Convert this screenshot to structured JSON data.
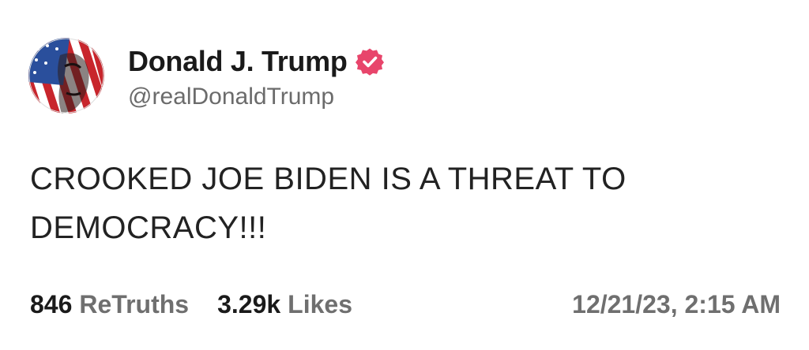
{
  "post": {
    "author": {
      "display_name": "Donald J. Trump",
      "handle": "@realDonaldTrump",
      "avatar_icon": "avatar-icon",
      "verified_icon": "verified-badge-icon"
    },
    "text_line_1": "CROOKED JOE BIDEN IS A THREAT TO",
    "text_line_2": "DEMOCRACY!!!",
    "stats": {
      "retruths_count": "846",
      "retruths_label": "ReTruths",
      "likes_count": "3.29k",
      "likes_label": "Likes"
    },
    "timestamp": "12/21/23, 2:15 AM"
  },
  "colors": {
    "verified_badge": "#e8456b",
    "handle": "#6b6b6b",
    "body_text": "#222222"
  }
}
